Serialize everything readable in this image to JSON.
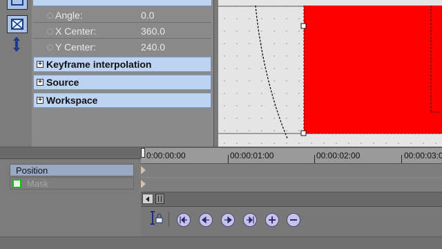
{
  "properties": {
    "rows": [
      {
        "label": "Angle:",
        "value": "0.0"
      },
      {
        "label": "X Center:",
        "value": "360.0"
      },
      {
        "label": "Y Center:",
        "value": "240.0"
      }
    ],
    "sections": [
      {
        "label": "Keyframe interpolation",
        "expander": "+"
      },
      {
        "label": "Source",
        "expander": "+"
      },
      {
        "label": "Workspace",
        "expander": "+"
      }
    ]
  },
  "tools": {
    "icons": [
      "selection-box-icon",
      "move-vertical-icon"
    ]
  },
  "tracks": {
    "items": [
      {
        "label": "Position"
      },
      {
        "label": "Mask"
      }
    ]
  },
  "timeline": {
    "ruler_labels": [
      "0:00:00:00",
      "00:00:01:00",
      "00:00:02:00",
      "00:00:03:0"
    ],
    "keyframe_buttons": [
      "first-keyframe-icon",
      "previous-keyframe-icon",
      "next-keyframe-icon",
      "last-keyframe-icon",
      "add-keyframe-icon",
      "delete-keyframe-icon"
    ]
  },
  "colors": {
    "section_bg": "#bcd3f1",
    "preview_bg": "#e5e5e5",
    "mask_fill": "#ff0000",
    "selected_track": "#9aa8c3"
  }
}
